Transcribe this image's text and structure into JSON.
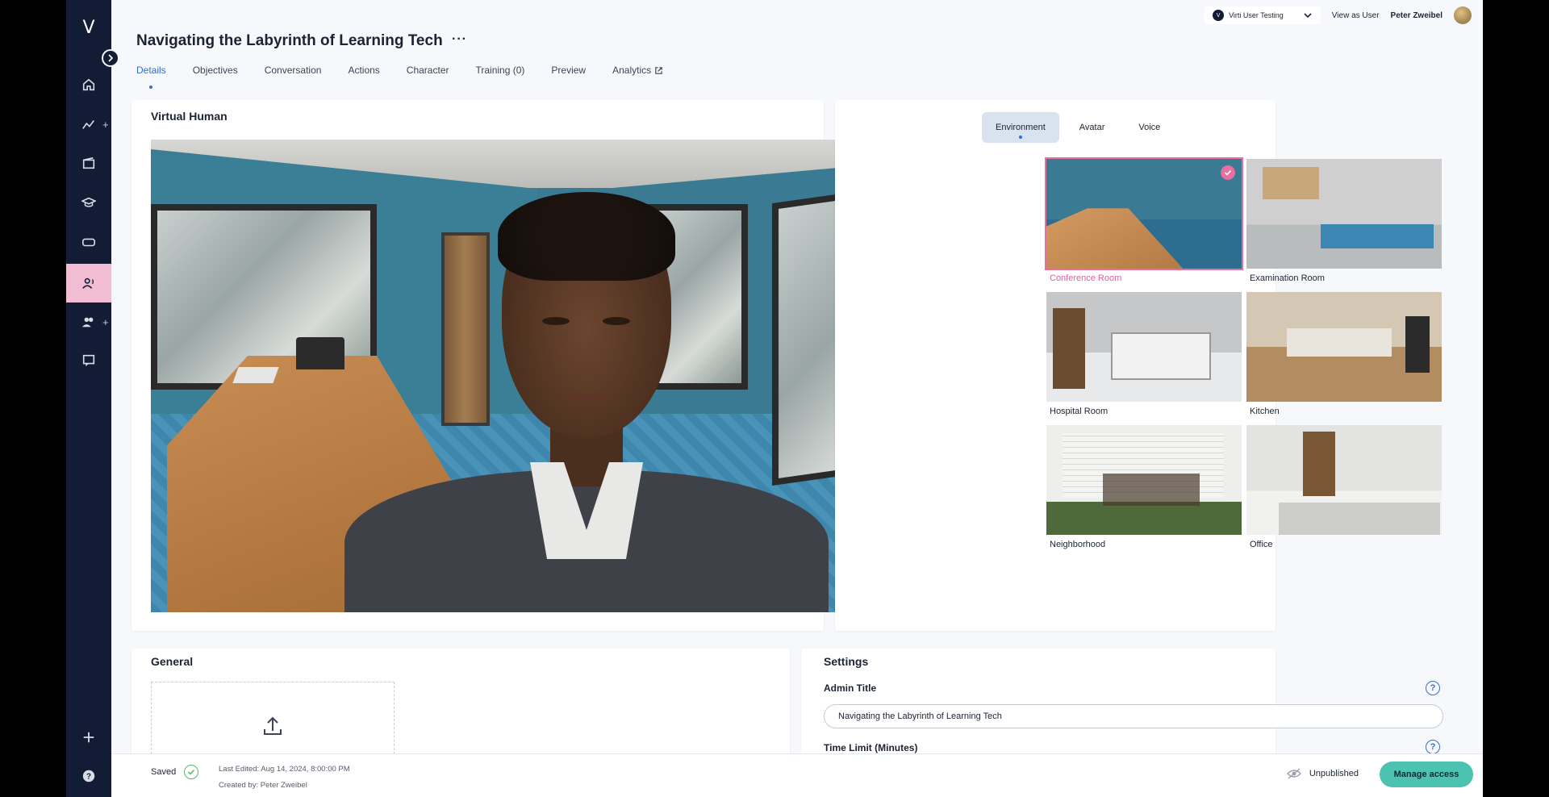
{
  "page": {
    "title": "Navigating the Labyrinth of Learning Tech",
    "more": "···"
  },
  "logo": "V",
  "topbar": {
    "org_badge": "V",
    "org": "Virti User Testing",
    "view_as": "View as User",
    "user": "Peter Zweibel"
  },
  "tabs": [
    {
      "label": "Details"
    },
    {
      "label": "Objectives"
    },
    {
      "label": "Conversation"
    },
    {
      "label": "Actions"
    },
    {
      "label": "Character"
    },
    {
      "label": "Training (0)"
    },
    {
      "label": "Preview"
    },
    {
      "label": "Analytics"
    }
  ],
  "virtual_human": {
    "title": "Virtual Human"
  },
  "environment_panel": {
    "tabs": [
      {
        "label": "Environment"
      },
      {
        "label": "Avatar"
      },
      {
        "label": "Voice"
      }
    ],
    "selected": "Conference Room",
    "environments": [
      {
        "label": "Conference Room"
      },
      {
        "label": "Examination Room"
      },
      {
        "label": "Hospital Room"
      },
      {
        "label": "Kitchen"
      },
      {
        "label": "Neighborhood"
      },
      {
        "label": "Office"
      }
    ]
  },
  "general": {
    "title": "General"
  },
  "settings": {
    "title": "Settings",
    "admin_title_label": "Admin Title",
    "admin_title_value": "Navigating the Labyrinth of Learning Tech",
    "time_limit_label": "Time Limit (Minutes)",
    "help": "?"
  },
  "footer": {
    "saved": "Saved",
    "last_edited": "Last Edited: Aug 14, 2024, 8:00:00 PM",
    "created_by": "Created by: Peter Zweibel",
    "status": "Unpublished",
    "manage_access": "Manage access"
  },
  "colors": {
    "sidebar": "#121c34",
    "accent_pink": "#e86fa0",
    "accent_blue": "#2f6fcf",
    "button_teal": "#4cc3b1"
  }
}
